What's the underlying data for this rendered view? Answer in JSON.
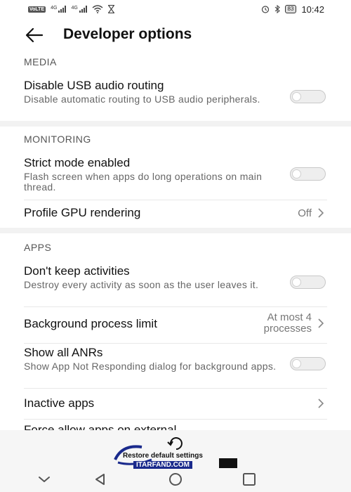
{
  "status_bar": {
    "volte": "VoLTE",
    "network1": "4G",
    "network2": "4G",
    "battery": "83",
    "time": "10:42"
  },
  "header": {
    "title": "Developer options"
  },
  "sections": {
    "media": "MEDIA",
    "monitoring": "MONITORING",
    "apps": "APPS"
  },
  "rows": {
    "usb_audio": {
      "title": "Disable USB audio routing",
      "desc": "Disable automatic routing to USB audio peripherals.",
      "enabled": false
    },
    "strict_mode": {
      "title": "Strict mode enabled",
      "desc": "Flash screen when apps do long operations on main thread.",
      "enabled": false
    },
    "gpu_rendering": {
      "title": "Profile GPU rendering",
      "value": "Off"
    },
    "keep_activities": {
      "title": "Don't keep activities",
      "desc": "Destroy every activity as soon as the user leaves it.",
      "enabled": false
    },
    "bg_limit": {
      "title": "Background process limit",
      "value": "At most 4 processes"
    },
    "anrs": {
      "title": "Show all ANRs",
      "desc": "Show App Not Responding dialog for background apps.",
      "enabled": false
    },
    "inactive": {
      "title": "Inactive apps"
    },
    "force_external": {
      "title": "Force allow apps on external"
    }
  },
  "watermark": {
    "restore": "Restore default settings",
    "brand": "ITARFAND.COM"
  },
  "colors": {
    "toggle_off_track": "#eeeeee",
    "section_band": "#f2f2f2"
  }
}
